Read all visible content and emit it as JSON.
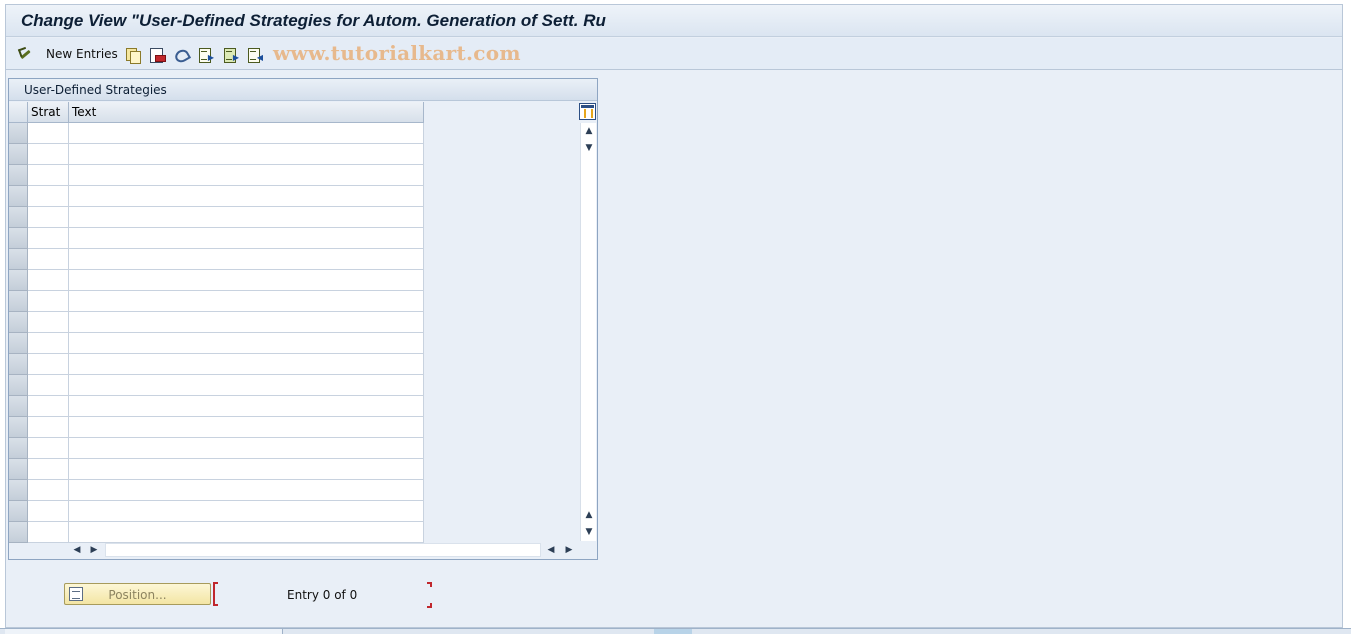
{
  "window": {
    "title": "Change View \"User-Defined Strategies for Autom. Generation of Sett. Ru"
  },
  "toolbar": {
    "new_entries_label": "New Entries",
    "icons": [
      "display-change-icon",
      "copy-icon",
      "delete-icon",
      "undo-icon",
      "select-all-icon",
      "select-block-icon",
      "deselect-all-icon"
    ]
  },
  "watermark": "www.tutorialkart.com",
  "panel": {
    "title": "User-Defined Strategies",
    "columns": [
      "Strat",
      "Text"
    ],
    "rows": [
      [
        "",
        ""
      ],
      [
        "",
        ""
      ],
      [
        "",
        ""
      ],
      [
        "",
        ""
      ],
      [
        "",
        ""
      ],
      [
        "",
        ""
      ],
      [
        "",
        ""
      ],
      [
        "",
        ""
      ],
      [
        "",
        ""
      ],
      [
        "",
        ""
      ],
      [
        "",
        ""
      ],
      [
        "",
        ""
      ],
      [
        "",
        ""
      ],
      [
        "",
        ""
      ],
      [
        "",
        ""
      ],
      [
        "",
        ""
      ],
      [
        "",
        ""
      ],
      [
        "",
        ""
      ],
      [
        "",
        ""
      ],
      [
        "",
        ""
      ]
    ]
  },
  "footer": {
    "position_button_label": "Position...",
    "entry_counter": "Entry 0 of 0"
  },
  "colors": {
    "background": "#e9eff7",
    "title_text": "#0d1f35",
    "watermark": "#e7b98d",
    "button_yellow": "#f3e5a4",
    "bracket_red": "#c0272d"
  }
}
